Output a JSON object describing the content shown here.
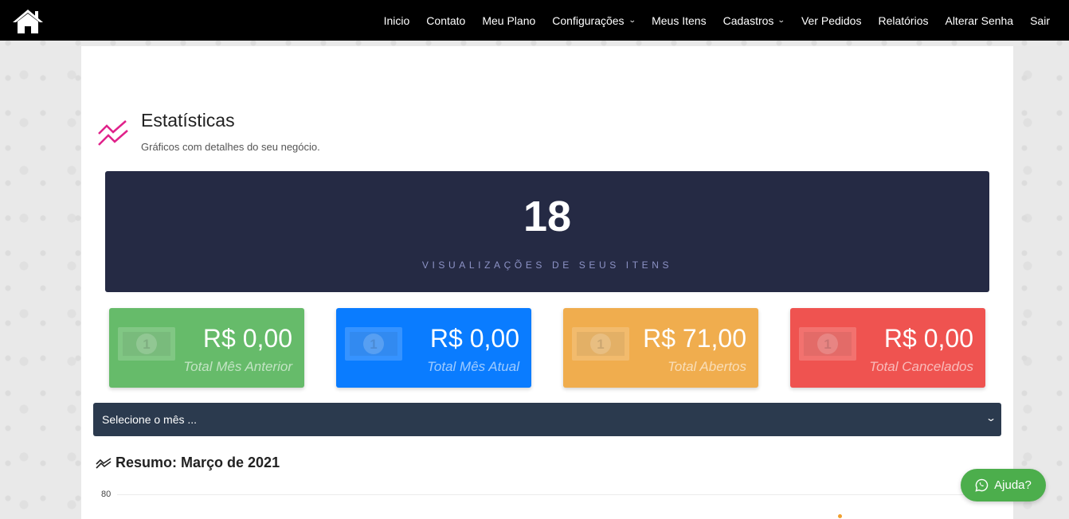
{
  "nav": {
    "items": [
      {
        "label": "Inicio",
        "dropdown": false
      },
      {
        "label": "Contato",
        "dropdown": false
      },
      {
        "label": "Meu Plano",
        "dropdown": false
      },
      {
        "label": "Configurações",
        "dropdown": true
      },
      {
        "label": "Meus Itens",
        "dropdown": false
      },
      {
        "label": "Cadastros",
        "dropdown": true
      },
      {
        "label": "Ver Pedidos",
        "dropdown": false
      },
      {
        "label": "Relatórios",
        "dropdown": false
      },
      {
        "label": "Alterar Senha",
        "dropdown": false
      },
      {
        "label": "Sair",
        "dropdown": false
      }
    ],
    "chevron": "⌄"
  },
  "header": {
    "title": "Estatísticas",
    "subtitle": "Gráficos com detalhes do seu negócio.",
    "icon": "trend-line-icon",
    "icon_color": "#e0218a"
  },
  "views": {
    "count": "18",
    "label": "VISUALIZAÇÕES DE SEUS ITENS"
  },
  "cards": [
    {
      "amount": "R$ 0,00",
      "label": "Total Mês Anterior",
      "color": "#66bb6a",
      "name": "card-total-mes-anterior"
    },
    {
      "amount": "R$ 0,00",
      "label": "Total Mês Atual",
      "color": "#0a7cff",
      "name": "card-total-mes-atual"
    },
    {
      "amount": "R$ 71,00",
      "label": "Total Abertos",
      "color": "#f0ad4e",
      "name": "card-total-abertos"
    },
    {
      "amount": "R$ 0,00",
      "label": "Total Cancelados",
      "color": "#ef5350",
      "name": "card-total-cancelados"
    }
  ],
  "month_select": {
    "value": "Selecione o mês ...",
    "caret": "⌄"
  },
  "resumo": {
    "title": "Resumo: Março de 2021",
    "icon": "trend-line-icon"
  },
  "chart_data": {
    "type": "line",
    "title": "",
    "y_ticks": [
      "80"
    ],
    "point_color": "#f0a030"
  },
  "help": {
    "label": "Ajuda?",
    "icon": "whatsapp-icon",
    "color": "#4cae4c"
  }
}
